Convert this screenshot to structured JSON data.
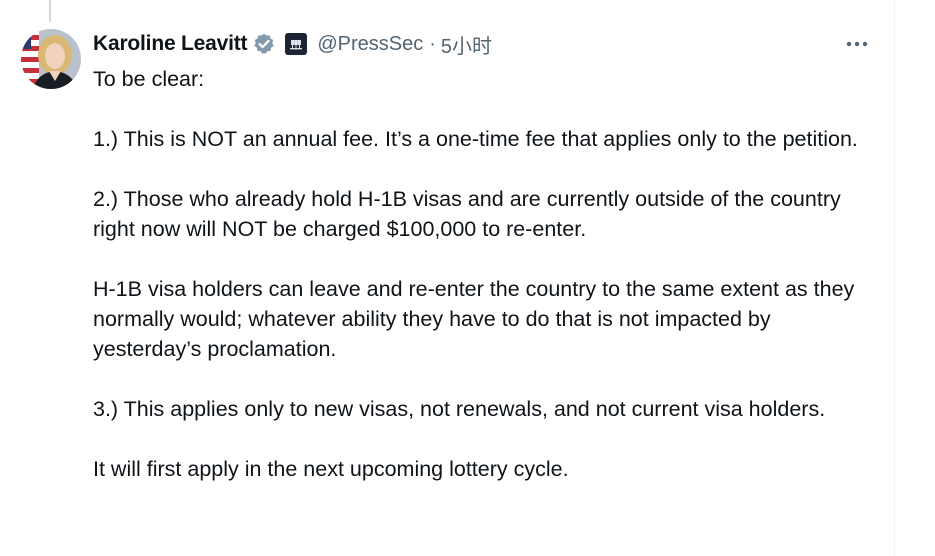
{
  "tweet": {
    "author": {
      "display_name": "Karoline Leavitt",
      "handle": "@PressSec",
      "separator": "·",
      "time": "5小时",
      "verified_icon": "verified-badge-icon",
      "affiliate_icon": "white-house-icon"
    },
    "paragraphs": [
      "To be clear:",
      "1.) This is NOT an annual fee. It’s a one-time fee that applies only to the petition.",
      "2.) Those who already hold H-1B visas and are currently outside of the country right now will NOT be charged $100,000 to re-enter.",
      "H-1B visa holders can leave and re-enter the country to the same extent as they normally would; whatever ability they have to do that is not impacted by yesterday’s proclamation.",
      "3.) This applies only to new visas, not renewals, and not current visa holders.",
      "It will first apply in the next upcoming lottery cycle."
    ],
    "more_icon": "more-horizontal-icon"
  },
  "colors": {
    "text": "#0f1419",
    "secondary": "#536471",
    "verified": "#829aab",
    "border": "#eff3f4"
  }
}
